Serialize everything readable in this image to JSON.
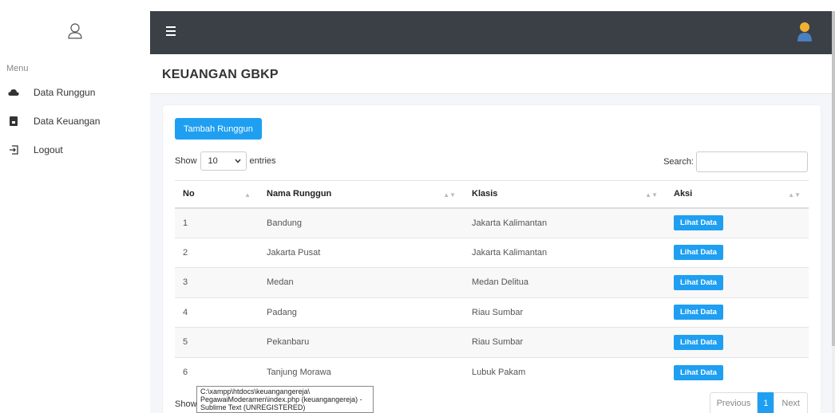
{
  "sidebar": {
    "menu_label": "Menu",
    "items": [
      {
        "label": "Data Runggun",
        "icon": "cloud-icon"
      },
      {
        "label": "Data Keuangan",
        "icon": "file-icon"
      },
      {
        "label": "Logout",
        "icon": "logout-icon"
      }
    ]
  },
  "topbar": {
    "menu_icon": "hamburger-icon",
    "avatar_icon": "user-avatar-icon"
  },
  "page": {
    "title": "KEUANGAN GBKP"
  },
  "card": {
    "add_button": "Tambah Runggun",
    "show_label": "Show",
    "entries_value": "10",
    "entries_label": "entries",
    "search_label": "Search:",
    "search_value": ""
  },
  "table": {
    "headers": [
      "No",
      "Nama Runggun",
      "Klasis",
      "Aksi"
    ],
    "rows": [
      {
        "no": "1",
        "nama": "Bandung",
        "klasis": "Jakarta Kalimantan",
        "aksi": "Lihat Data"
      },
      {
        "no": "2",
        "nama": "Jakarta Pusat",
        "klasis": "Jakarta Kalimantan",
        "aksi": "Lihat Data"
      },
      {
        "no": "3",
        "nama": "Medan",
        "klasis": "Medan Delitua",
        "aksi": "Lihat Data"
      },
      {
        "no": "4",
        "nama": "Padang",
        "klasis": "Riau Sumbar",
        "aksi": "Lihat Data"
      },
      {
        "no": "5",
        "nama": "Pekanbaru",
        "klasis": "Riau Sumbar",
        "aksi": "Lihat Data"
      },
      {
        "no": "6",
        "nama": "Tanjung Morawa",
        "klasis": "Lubuk Pakam",
        "aksi": "Lihat Data"
      }
    ]
  },
  "footer": {
    "show_text": "Show",
    "prev": "Previous",
    "page": "1",
    "next": "Next"
  },
  "tooltip": {
    "line1": "C:\\xampp\\htdocs\\keuangangereja\\",
    "line2": "PegawaiModeramen\\index.php (keuangangereja) -",
    "line3": "Sublime Text (UNREGISTERED)"
  },
  "colors": {
    "accent": "#1e9ff2",
    "topbar": "#3a4046"
  }
}
